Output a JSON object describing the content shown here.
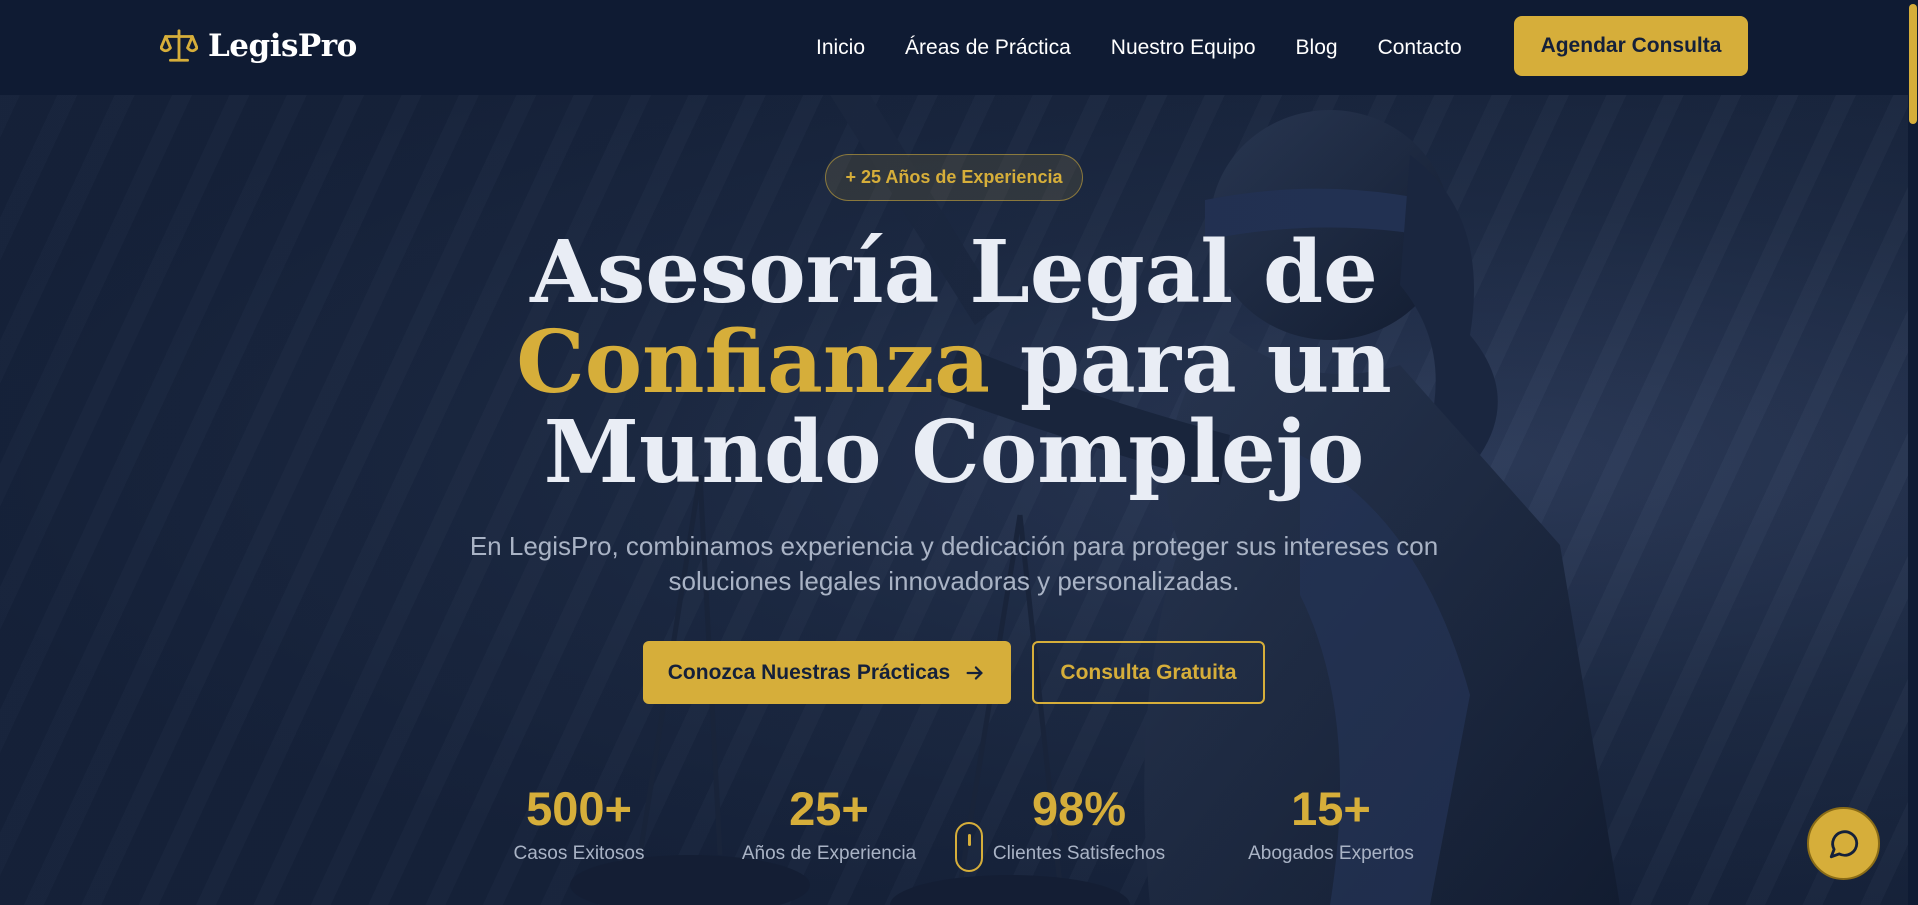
{
  "brand": {
    "name": "LegisPro",
    "icon": "scales-icon"
  },
  "nav": {
    "links": [
      "Inicio",
      "Áreas de Práctica",
      "Nuestro Equipo",
      "Blog",
      "Contacto"
    ],
    "cta": "Agendar Consulta"
  },
  "hero": {
    "badge": "+ 25 Años de Experiencia",
    "headline": {
      "line1": "Asesoría Legal de",
      "accent": "Confianza",
      "line2_rest": " para un",
      "line3": "Mundo Complejo"
    },
    "subtitle": "En LegisPro, combinamos experiencia y dedicación para proteger sus intereses con soluciones legales innovadoras y personalizadas.",
    "primary_button": "Conozca Nuestras Prácticas",
    "secondary_button": "Consulta Gratuita"
  },
  "stats": [
    {
      "value": "500+",
      "label": "Casos Exitosos"
    },
    {
      "value": "25+",
      "label": "Años de Experiencia"
    },
    {
      "value": "98%",
      "label": "Clientes Satisfechos"
    },
    {
      "value": "15+",
      "label": "Abogados Expertos"
    }
  ],
  "colors": {
    "accent": "#d6ae3a",
    "navy": "#0f1b33",
    "text_muted": "#a9b3c5"
  },
  "icons": {
    "chat": "chat-bubble-icon",
    "arrow": "arrow-right-icon",
    "scroll": "mouse-scroll-icon"
  }
}
